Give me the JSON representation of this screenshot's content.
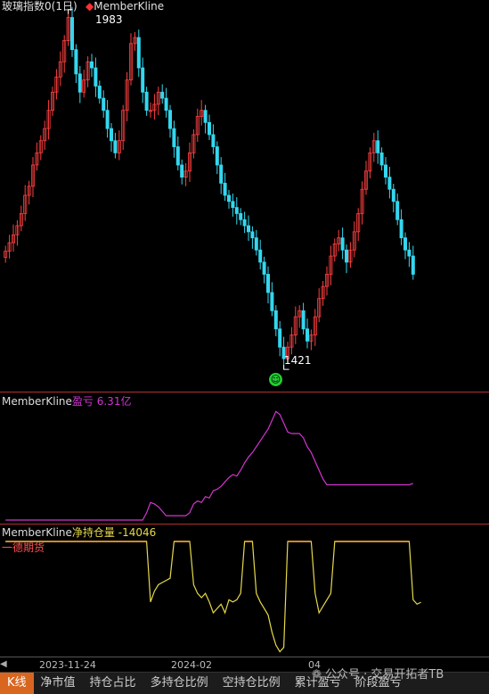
{
  "panel1": {
    "title": "玻璃指数0(1日)",
    "indicator": "MemberKline",
    "high_label": "1983",
    "low_label": "1421"
  },
  "panel2": {
    "name": "MemberKline",
    "metric": "盈亏",
    "value": "6.31亿"
  },
  "panel3": {
    "name": "MemberKline",
    "metric": "净持仓量",
    "value": "-14046",
    "member": "一德期货"
  },
  "x_axis": {
    "labels": [
      "2023-11-24",
      "2024-02",
      "04"
    ]
  },
  "tabs": [
    "K线",
    "净市值",
    "持仓占比",
    "多持仓比例",
    "空持仓比例",
    "累计盈亏",
    "阶段盈亏"
  ],
  "watermark": "公众号 · 交易开拓者TB",
  "colors": {
    "background": "#000000",
    "up": "#ff4040",
    "down": "#34d7ef",
    "divider": "#b03030",
    "pnl_line": "#d235d2",
    "position_line": "#e6d94a",
    "position_cap": "#f0a030",
    "tab_active": "#d9661f"
  },
  "chart_data": [
    {
      "type": "candlestick",
      "title": "玻璃指数0(1日)",
      "x": [
        "2023-11-24",
        "2024-02",
        "04"
      ],
      "series": [
        {
          "name": "玻璃指数0",
          "values": [
            1598,
            1612,
            1625,
            1640,
            1660,
            1690,
            1705,
            1740,
            1760,
            1780,
            1800,
            1830,
            1860,
            1885,
            1910,
            1945,
            1983,
            1930,
            1890,
            1860,
            1880,
            1910,
            1900,
            1870,
            1850,
            1830,
            1800,
            1780,
            1760,
            1780,
            1830,
            1880,
            1940,
            1950,
            1900,
            1860,
            1830,
            1830,
            1840,
            1860,
            1850,
            1830,
            1800,
            1770,
            1740,
            1720,
            1730,
            1760,
            1790,
            1820,
            1830,
            1810,
            1790,
            1770,
            1740,
            1710,
            1690,
            1680,
            1670,
            1660,
            1650,
            1640,
            1630,
            1620,
            1600,
            1580,
            1560,
            1530,
            1500,
            1470,
            1440,
            1421,
            1440,
            1460,
            1490,
            1500,
            1470,
            1450,
            1460,
            1490,
            1520,
            1540,
            1560,
            1590,
            1610,
            1620,
            1600,
            1580,
            1600,
            1630,
            1660,
            1700,
            1730,
            1760,
            1780,
            1760,
            1740,
            1720,
            1700,
            1680,
            1650,
            1620,
            1600,
            1590,
            1560
          ]
        }
      ],
      "annotations": [
        "1983",
        "1421"
      ]
    },
    {
      "type": "line",
      "series": [
        {
          "name": "盈亏",
          "values": [
            0.0,
            0.0,
            0.0,
            0.0,
            0.0,
            0.0,
            0.0,
            0.0,
            0.0,
            0.0,
            0.0,
            0.0,
            0.0,
            0.0,
            0.0,
            0.0,
            0.0,
            0.0,
            0.0,
            0.0,
            0.0,
            0.0,
            0.0,
            0.0,
            0.0,
            0.0,
            0.0,
            0.0,
            0.0,
            0.0,
            0.0,
            0.0,
            0.0,
            0.0,
            0.0,
            0.0,
            0.5,
            1.2,
            1.1,
            0.9,
            0.6,
            0.3,
            0.3,
            0.3,
            0.3,
            0.3,
            0.3,
            0.5,
            1.1,
            1.3,
            1.2,
            1.6,
            1.5,
            2.0,
            2.1,
            2.3,
            2.6,
            2.9,
            3.1,
            3.0,
            3.4,
            3.9,
            4.3,
            4.6,
            5.0,
            5.4,
            5.8,
            6.2,
            6.8,
            7.4,
            7.2,
            6.6,
            6.0,
            5.9,
            5.9,
            5.9,
            5.6,
            5.0,
            4.6,
            4.0,
            3.4,
            2.8,
            2.4,
            2.4,
            2.4,
            2.4,
            2.4,
            2.4,
            2.4,
            2.4,
            2.4,
            2.4,
            2.4,
            2.4,
            2.4,
            2.4,
            2.4,
            2.4,
            2.4,
            2.4,
            2.4,
            2.4,
            2.4,
            2.4,
            2.5
          ]
        }
      ]
    },
    {
      "type": "line",
      "series": [
        {
          "name": "净持仓量",
          "values": [
            0,
            0,
            0,
            0,
            0,
            0,
            0,
            0,
            0,
            0,
            0,
            0,
            0,
            0,
            0,
            0,
            0,
            0,
            0,
            0,
            0,
            0,
            0,
            0,
            0,
            0,
            0,
            0,
            0,
            0,
            0,
            0,
            0,
            0,
            0,
            0,
            0,
            -14000,
            -11500,
            -10000,
            -9500,
            -9000,
            -8500,
            0,
            0,
            0,
            0,
            0,
            -10000,
            -12000,
            -13000,
            -12000,
            -14000,
            -16500,
            -15500,
            -14500,
            -16500,
            -13500,
            -14000,
            -13500,
            -12000,
            0,
            0,
            0,
            -12000,
            -14000,
            -15500,
            -17000,
            -21000,
            -24000,
            -25500,
            -24500,
            0,
            0,
            0,
            0,
            0,
            0,
            0,
            -12000,
            -16500,
            -15000,
            -13500,
            -12000,
            0,
            0,
            0,
            0,
            0,
            0,
            0,
            0,
            0,
            0,
            0,
            0,
            0,
            0,
            0,
            0,
            0,
            0,
            0,
            0,
            -13500,
            -14500,
            -14046
          ]
        }
      ]
    }
  ]
}
